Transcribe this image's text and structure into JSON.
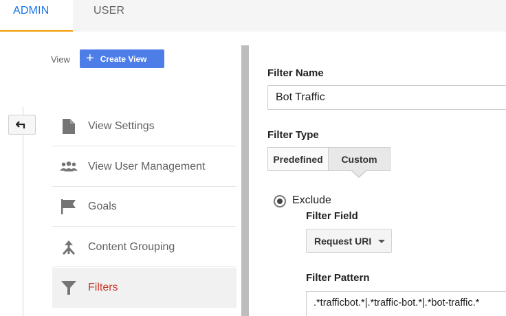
{
  "tabs": {
    "admin": "ADMIN",
    "user": "USER"
  },
  "sidebar": {
    "view_label": "View",
    "create_view_label": "Create View",
    "items": [
      {
        "label": "View Settings",
        "icon": "document-icon"
      },
      {
        "label": "View User Management",
        "icon": "users-icon"
      },
      {
        "label": "Goals",
        "icon": "flag-icon"
      },
      {
        "label": "Content Grouping",
        "icon": "content-grouping-icon"
      },
      {
        "label": "Filters",
        "icon": "filter-icon",
        "active": true
      }
    ]
  },
  "form": {
    "filter_name_label": "Filter Name",
    "filter_name_value": "Bot Traffic",
    "filter_type_label": "Filter Type",
    "filter_type_options": [
      "Predefined",
      "Custom"
    ],
    "filter_type_selected": "Custom",
    "exclude_label": "Exclude",
    "filter_field_label": "Filter Field",
    "filter_field_value": "Request URI",
    "filter_pattern_label": "Filter Pattern",
    "filter_pattern_value": ".*trafficbot.*|.*traffic-bot.*|.*bot-traffic.*"
  },
  "colors": {
    "accent_blue": "#1a73e8",
    "tab_underline": "#f29900",
    "create_button": "#4d7ee8",
    "active_filter_text": "#c8382b"
  }
}
